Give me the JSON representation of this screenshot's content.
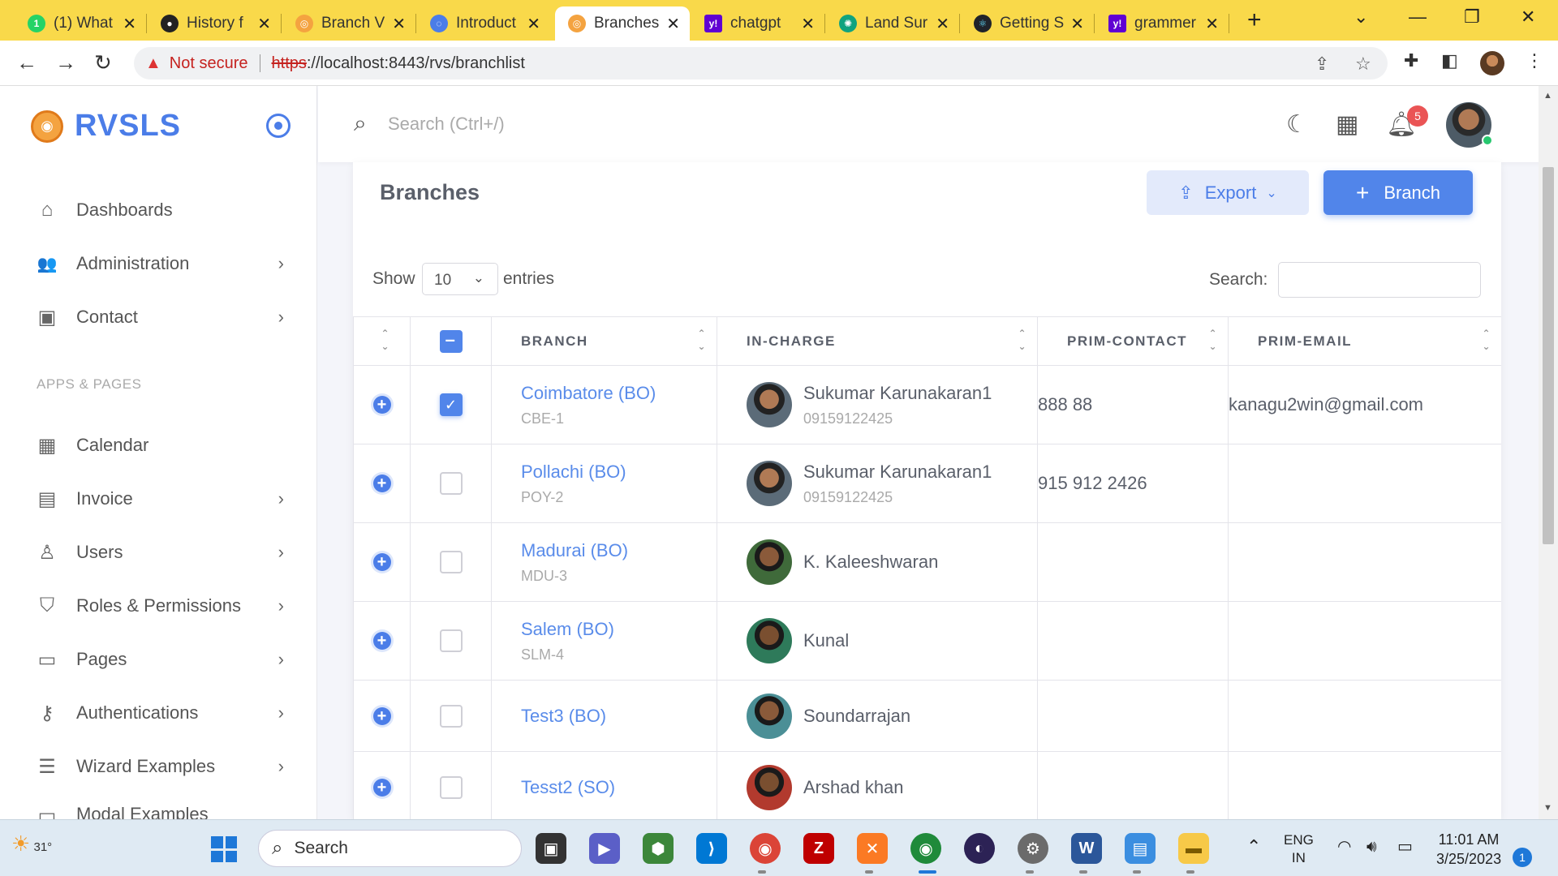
{
  "browser": {
    "tabs": [
      {
        "title": "(1) What",
        "favicon": "whatsapp-icon",
        "color": "#25d366",
        "glyph": "1"
      },
      {
        "title": "History f",
        "favicon": "github-icon",
        "color": "#222222",
        "glyph": "●"
      },
      {
        "title": "Branch V",
        "favicon": "rvsls-icon",
        "color": "#f4a340",
        "glyph": "◎"
      },
      {
        "title": "Introduct",
        "favicon": "loading-icon",
        "color": "#4b7de8",
        "glyph": "◌"
      },
      {
        "title": "Branches",
        "favicon": "rvsls-icon",
        "color": "#f4a340",
        "glyph": "◎"
      },
      {
        "title": "chatgpt",
        "favicon": "yahoo-icon",
        "color": "#6001d2",
        "glyph": "y!"
      },
      {
        "title": "Land Sur",
        "favicon": "chatgpt-icon",
        "color": "#10a37f",
        "glyph": "✺"
      },
      {
        "title": "Getting S",
        "favicon": "react-icon",
        "color": "#20232a",
        "glyph": "⚛"
      },
      {
        "title": "grammer",
        "favicon": "yahoo-icon",
        "color": "#6001d2",
        "glyph": "y!"
      }
    ],
    "active_tab_index": 4,
    "security_label": "Not secure",
    "url_scheme": "https",
    "url_rest": "://localhost:8443/rvs/branchlist"
  },
  "app": {
    "brand": "RVSLS",
    "search_placeholder": "Search (Ctrl+/)",
    "notification_count": "5"
  },
  "sidebar": {
    "items": [
      {
        "label": "Dashboards",
        "icon": "home-icon",
        "glyph": "⌂",
        "has_chevron": false
      },
      {
        "label": "Administration",
        "icon": "users-icon",
        "glyph": "👥",
        "has_chevron": true
      },
      {
        "label": "Contact",
        "icon": "contact-icon",
        "glyph": "▣",
        "has_chevron": true
      }
    ],
    "section_title": "APPS & PAGES",
    "apps": [
      {
        "label": "Calendar",
        "icon": "calendar-icon",
        "glyph": "▦",
        "has_chevron": false
      },
      {
        "label": "Invoice",
        "icon": "invoice-icon",
        "glyph": "▤",
        "has_chevron": true
      },
      {
        "label": "Users",
        "icon": "user-icon",
        "glyph": "♙",
        "has_chevron": true
      },
      {
        "label": "Roles & Permissions",
        "icon": "shield-icon",
        "glyph": "⛉",
        "has_chevron": true
      },
      {
        "label": "Pages",
        "icon": "pages-icon",
        "glyph": "▭",
        "has_chevron": true
      },
      {
        "label": "Authentications",
        "icon": "auth-icon",
        "glyph": "⚷",
        "has_chevron": true
      },
      {
        "label": "Wizard Examples",
        "icon": "wizard-icon",
        "glyph": "☰",
        "has_chevron": true
      },
      {
        "label": "Modal Examples",
        "icon": "modal-icon",
        "glyph": "▭",
        "has_chevron": false
      }
    ]
  },
  "page": {
    "title": "Branches",
    "export_label": "Export",
    "add_label": "Branch",
    "show_label": "Show",
    "entries_value": "10",
    "entries_label": "entries",
    "search_label": "Search:",
    "search_value": ""
  },
  "table": {
    "columns": [
      "BRANCH",
      "IN-CHARGE",
      "PRIM-CONTACT",
      "PRIM-EMAIL"
    ],
    "rows": [
      {
        "branch": "Coimbatore (BO)",
        "code": "CBE-1",
        "incharge": "Sukumar Karunakaran1",
        "phone": "09159122425",
        "contact": "888 88",
        "email": "kanagu2win@gmail.com",
        "checked": true,
        "avatar_color": "#5b6b78"
      },
      {
        "branch": "Pollachi (BO)",
        "code": "POY-2",
        "incharge": "Sukumar Karunakaran1",
        "phone": "09159122425",
        "contact": "915 912 2426",
        "email": "",
        "checked": false,
        "avatar_color": "#5b6b78"
      },
      {
        "branch": "Madurai (BO)",
        "code": "MDU-3",
        "incharge": "K. Kaleeshwaran",
        "phone": "",
        "contact": "",
        "email": "",
        "checked": false,
        "avatar_color": "#3f6a3a"
      },
      {
        "branch": "Salem (BO)",
        "code": "SLM-4",
        "incharge": "Kunal",
        "phone": "",
        "contact": "",
        "email": "",
        "checked": false,
        "avatar_color": "#2e7a5a"
      },
      {
        "branch": "Test3 (BO)",
        "code": "",
        "incharge": "Soundarrajan",
        "phone": "",
        "contact": "",
        "email": "",
        "checked": false,
        "avatar_color": "#4b8f96"
      },
      {
        "branch": "Tesst2 (SO)",
        "code": "",
        "incharge": "Arshad khan",
        "phone": "",
        "contact": "",
        "email": "",
        "checked": false,
        "avatar_color": "#b23a2e"
      }
    ]
  },
  "taskbar": {
    "weather": "31°",
    "search_label": "Search",
    "language_line1": "ENG",
    "language_line2": "IN",
    "time": "11:01 AM",
    "date": "3/25/2023",
    "notifications": "1"
  }
}
